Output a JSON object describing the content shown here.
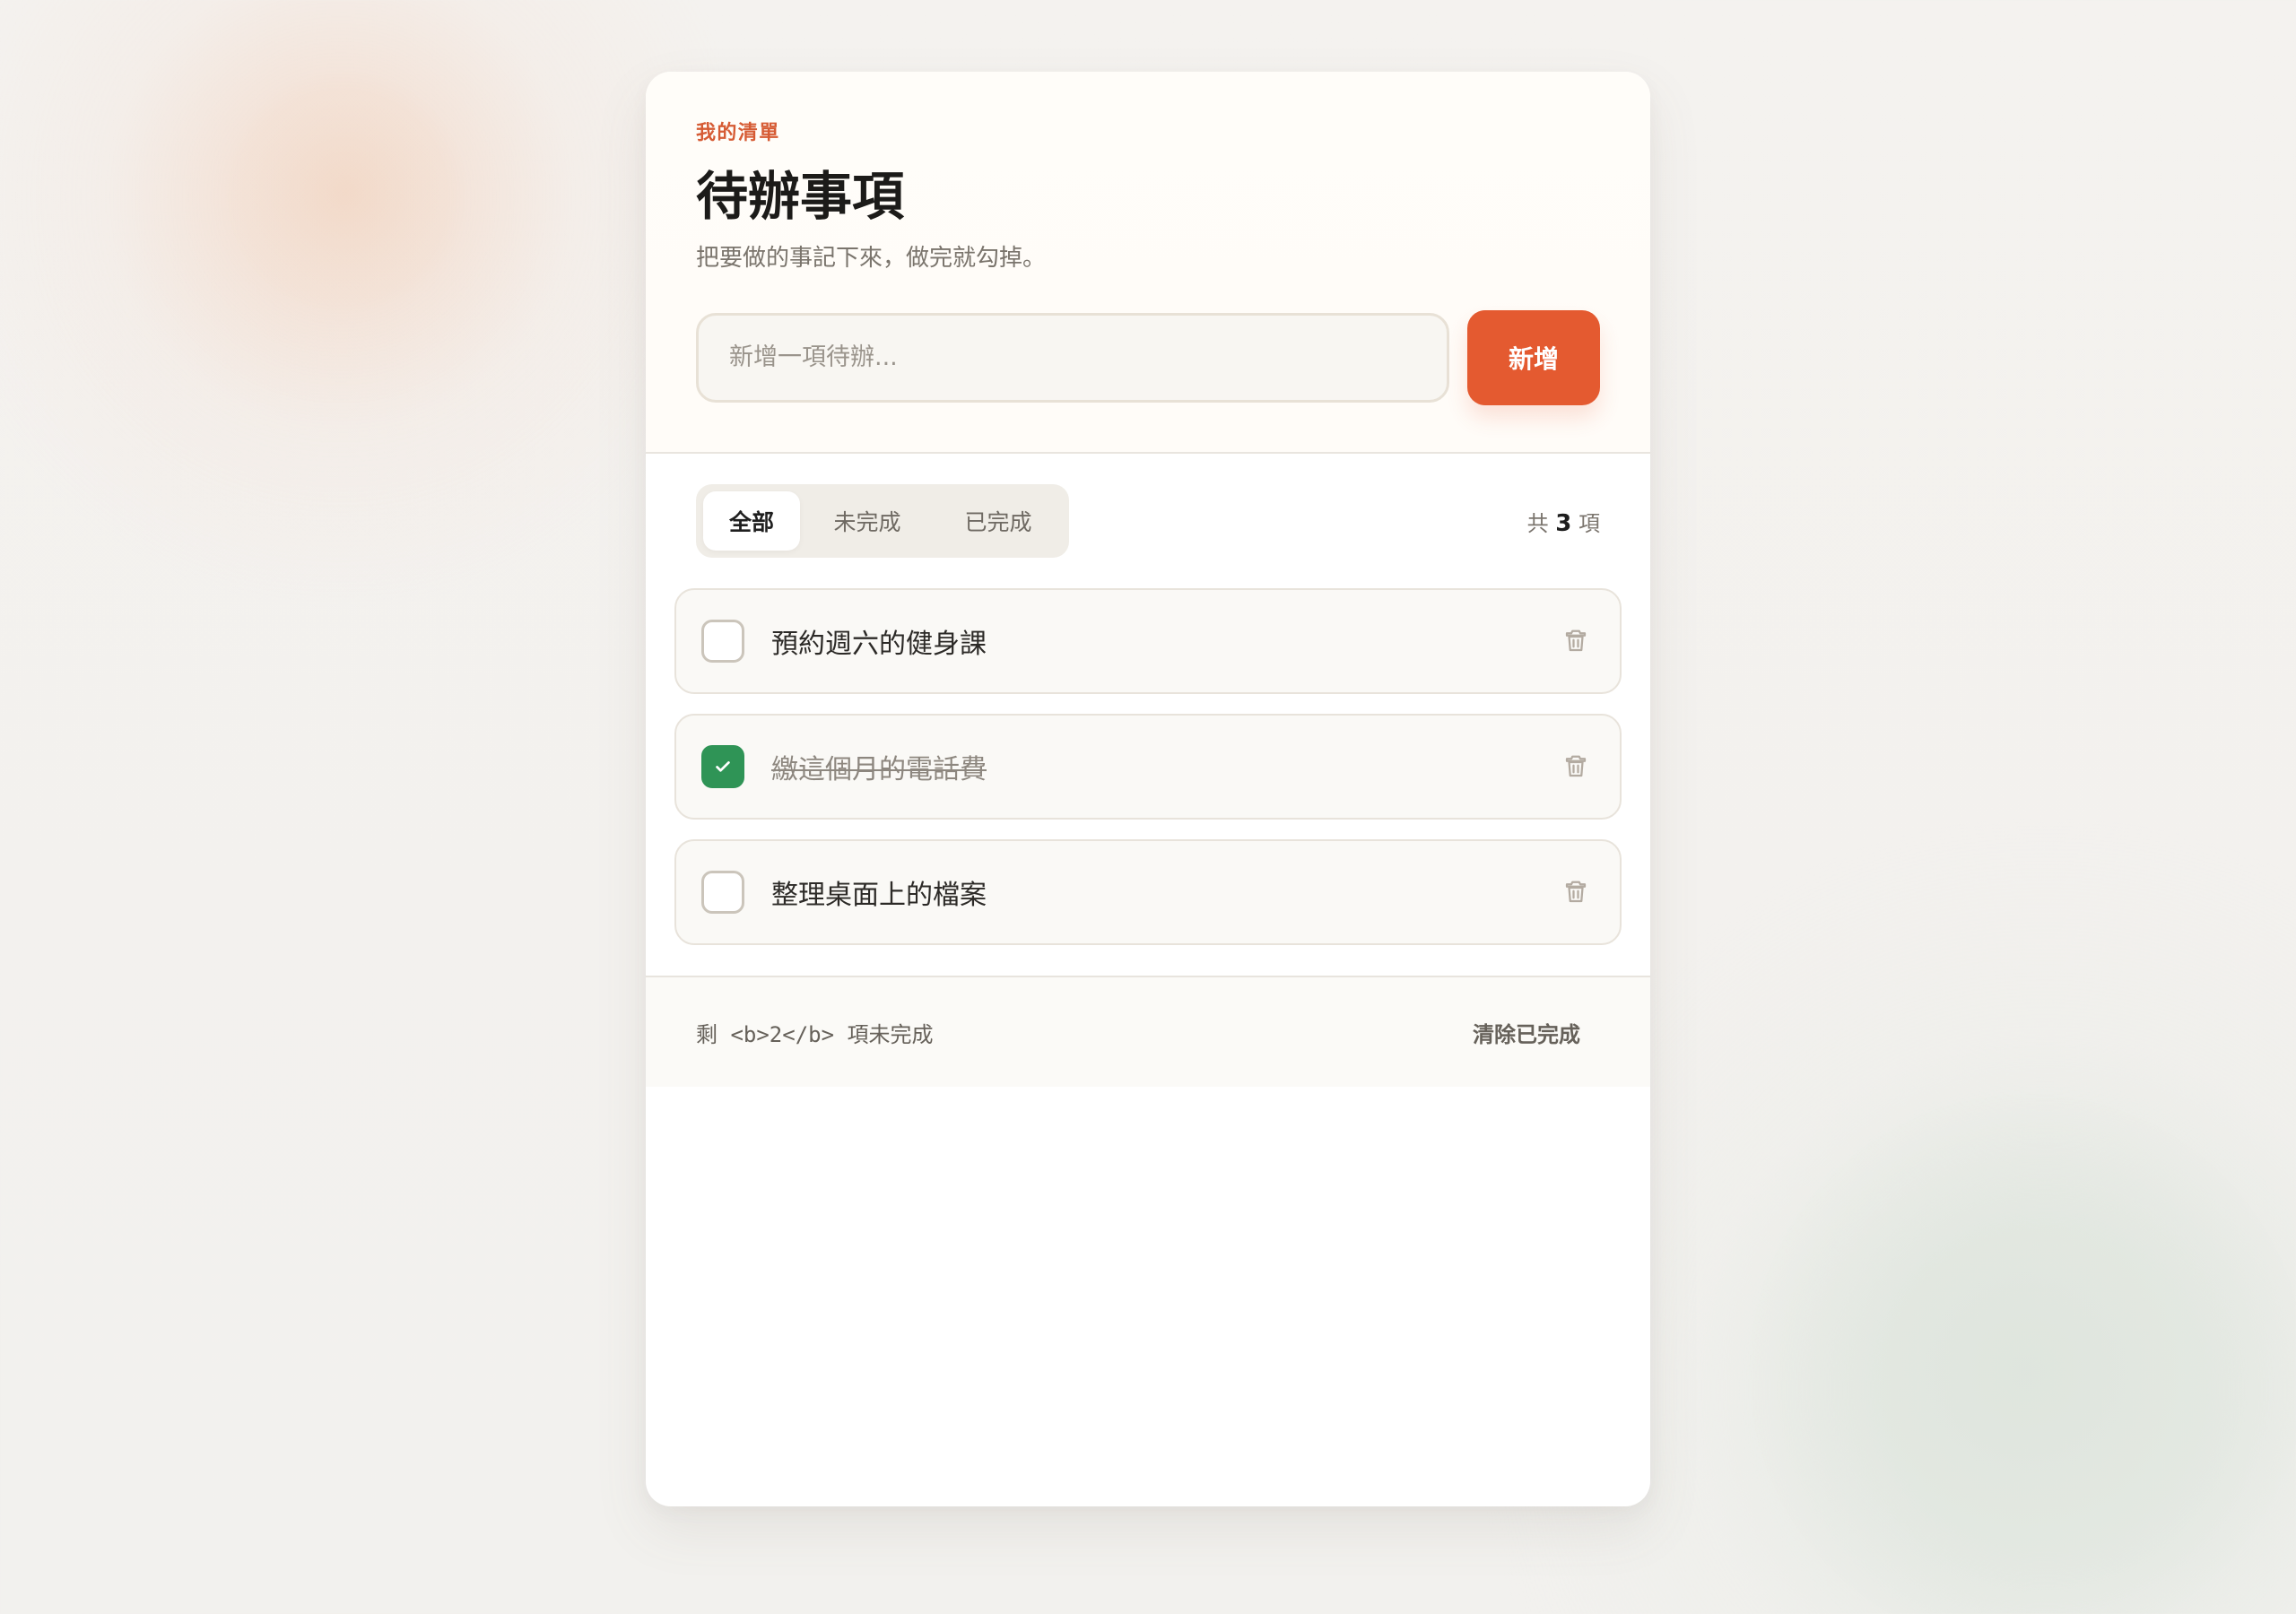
{
  "header": {
    "eyebrow": "我的清單",
    "title": "待辦事項",
    "subtitle": "把要做的事記下來，做完就勾掉。",
    "input_placeholder": "新增一項待辦...",
    "add_label": "新增"
  },
  "filters": {
    "tabs": [
      {
        "label": "全部",
        "active": true
      },
      {
        "label": "未完成",
        "active": false
      },
      {
        "label": "已完成",
        "active": false
      }
    ],
    "count_prefix": "共",
    "count_value": "3",
    "count_suffix": "項"
  },
  "todos": [
    {
      "text": "預約週六的健身課",
      "completed": false
    },
    {
      "text": "繳這個月的電話費",
      "completed": true
    },
    {
      "text": "整理桌面上的檔案",
      "completed": false
    }
  ],
  "footer": {
    "remaining_text": "剩 <b>2</b> 項未完成",
    "clear_label": "清除已完成"
  },
  "icons": {
    "checkbox_checked": "check-icon",
    "delete": "trash-icon"
  },
  "colors": {
    "accent": "#e45a30",
    "success": "#2f9456",
    "surface": "#ffffff"
  }
}
